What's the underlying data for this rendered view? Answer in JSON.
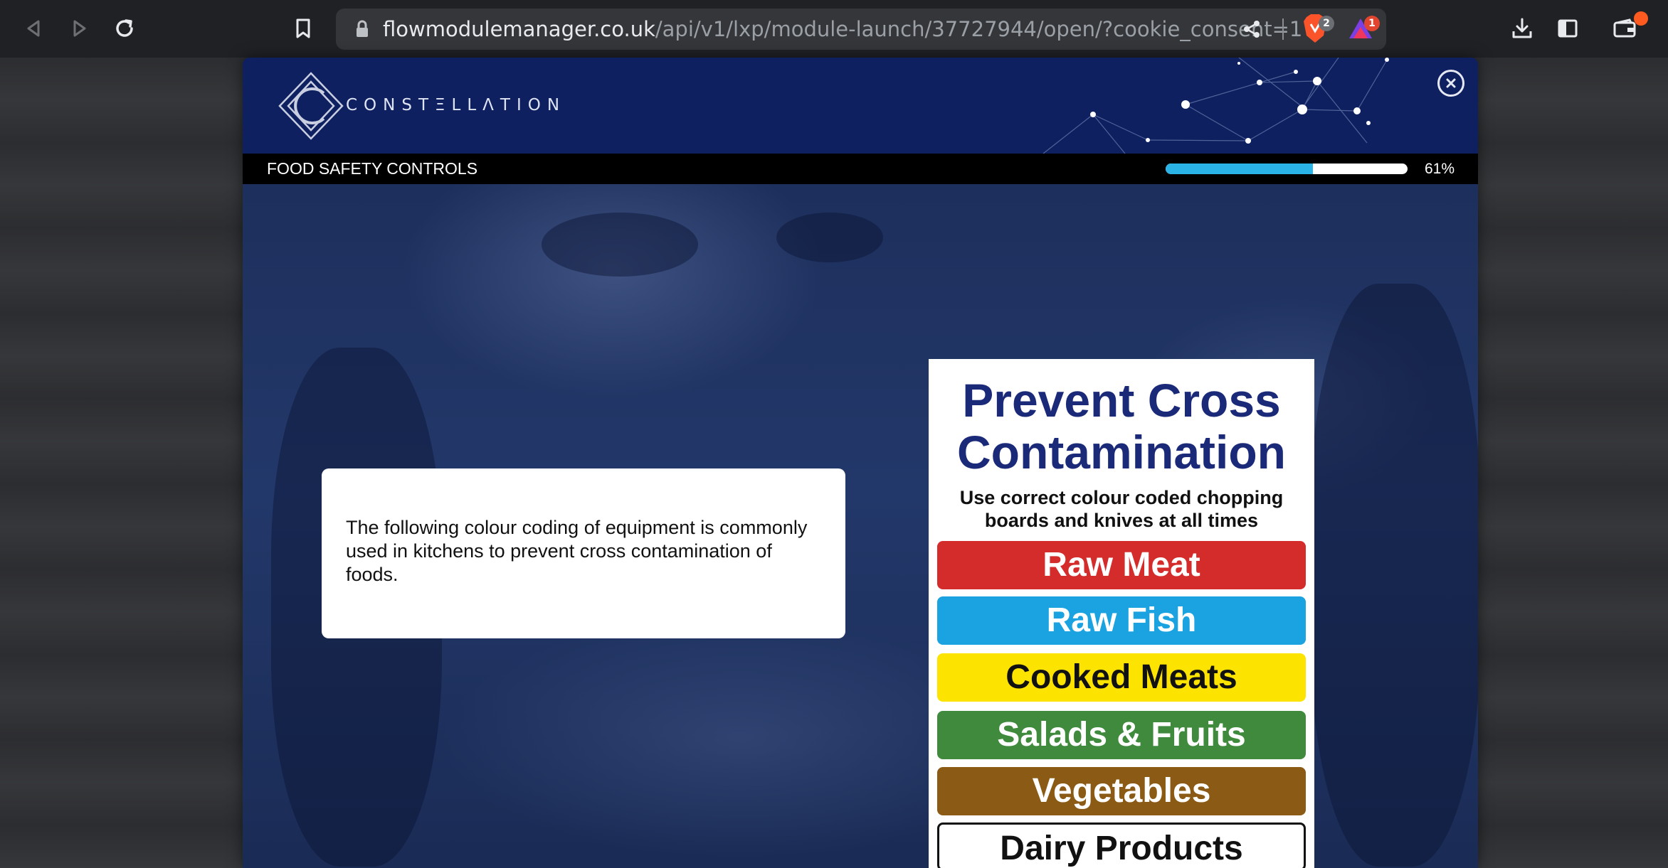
{
  "browser": {
    "url_host": "flowmodulemanager.co.uk",
    "url_path": "/api/v1/lxp/module-launch/37727944/open/?cookie_consent=1",
    "brave_badge": "2",
    "rewards_badge": "1"
  },
  "module": {
    "brand": "CONSTΞLLΛTION",
    "course_title": "FOOD SAFETY CONTROLS",
    "progress_percent": 61,
    "progress_label": "61%"
  },
  "content": {
    "intro_text": "The following colour coding of equipment is commonly used in kitchens to prevent cross contamination of foods."
  },
  "sign": {
    "title_line1": "Prevent Cross",
    "title_line2": "Contamination",
    "subtitle_line1": "Use correct colour coded chopping",
    "subtitle_line2": "boards and knives at all times",
    "bands": [
      {
        "label": "Raw Meat",
        "bg": "#d42b2b",
        "fg": "#ffffff"
      },
      {
        "label": "Raw Fish",
        "bg": "#1aa3e0",
        "fg": "#ffffff"
      },
      {
        "label": "Cooked Meats",
        "bg": "#fde400",
        "fg": "#111111"
      },
      {
        "label": "Salads & Fruits",
        "bg": "#3f8a3d",
        "fg": "#ffffff"
      },
      {
        "label": "Vegetables",
        "bg": "#8b5a14",
        "fg": "#ffffff"
      },
      {
        "label": "Dairy Products",
        "bg": "#ffffff",
        "fg": "#111111"
      }
    ]
  },
  "colors": {
    "header_bg": "#0e2060",
    "progress_fill": "#2ab3e6",
    "sign_title": "#1b2a78"
  }
}
